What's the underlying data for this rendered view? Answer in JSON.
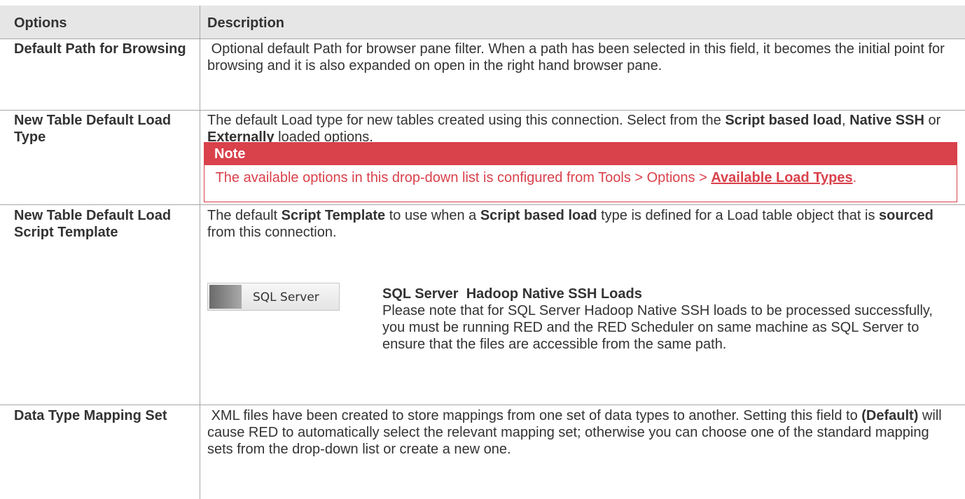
{
  "table": {
    "headers": {
      "options": "Options",
      "description": "Description"
    },
    "rows": [
      {
        "option": "Default Path for Browsing",
        "description": " Optional default Path for browser pane filter. When a path has been selected in this field, it becomes the initial point for browsing and it is also expanded on open in the right hand browser pane."
      },
      {
        "option": "New Table Default Load Type",
        "desc_1": "The default Load type for new tables created using this connection. Select from the ",
        "desc_b1": "Script based load",
        "desc_2": ", ",
        "desc_b2": "Native SSH",
        "desc_3": " or ",
        "desc_b3": "Externally",
        "desc_4": " loaded options.",
        "note": {
          "title": "Note",
          "text": " The available options in this drop-down list is configured from Tools > Options > ",
          "link": "Available Load Types",
          "end": "."
        }
      },
      {
        "option": "New Table Default Load Script Template",
        "desc_1": "The default ",
        "desc_b1": "Script Template",
        "desc_2": " to use when a ",
        "desc_b2": "Script based load",
        "desc_3": " type is defined for a Load table object that is ",
        "desc_b3": "sourced",
        "desc_4": " from this connection.",
        "image_label": "SQL Server",
        "sub_title": "SQL Server  Hadoop Native SSH Loads",
        "sub_text": "Please note that for SQL Server Hadoop Native SSH loads to be processed successfully, you must be running RED and the RED Scheduler on same machine as SQL Server to ensure that the files are accessible from the same path."
      },
      {
        "option": "Data Type Mapping Set",
        "desc_1": " XML files have been created to store mappings from one set of data types to another. Setting this field to ",
        "desc_b1": "(Default)",
        "desc_2": " will cause RED to automatically select the relevant mapping set; otherwise you can choose one of the standard mapping sets from the drop-down list or create a new one."
      }
    ]
  },
  "colors": {
    "header_bg": "#e6e6e6",
    "note_red": "#d9414b",
    "grid": "#a6a6a6"
  }
}
